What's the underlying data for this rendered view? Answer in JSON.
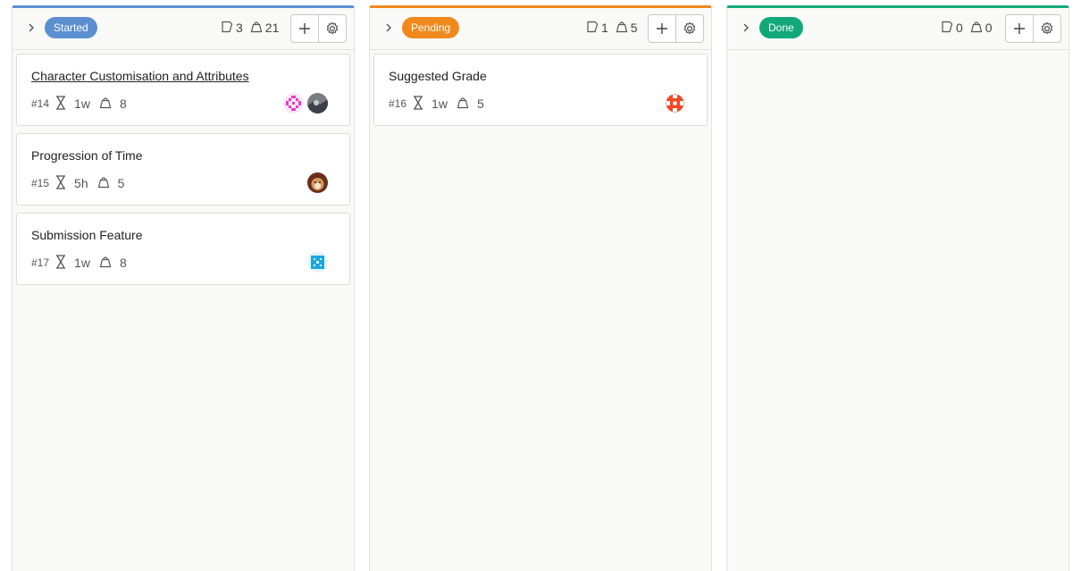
{
  "columns": [
    {
      "badge": "Started",
      "color": "#5b8fd0",
      "issue_count": "3",
      "weight_count": "21",
      "cards": [
        {
          "title": "Character Customisation and Attributes",
          "number": "#14",
          "estimate": "1w",
          "weight": "8",
          "avatars": [
            "pink-identicon",
            "photo-avatar"
          ]
        },
        {
          "title": "Progression of Time",
          "number": "#15",
          "estimate": "5h",
          "weight": "5",
          "avatars": [
            "dog-photo-avatar"
          ]
        },
        {
          "title": "Submission Feature",
          "number": "#17",
          "estimate": "1w",
          "weight": "8",
          "avatars": [
            "blue-identicon"
          ]
        }
      ]
    },
    {
      "badge": "Pending",
      "color": "#f0891c",
      "issue_count": "1",
      "weight_count": "5",
      "cards": [
        {
          "title": "Suggested Grade",
          "number": "#16",
          "estimate": "1w",
          "weight": "5",
          "avatars": [
            "red-identicon"
          ]
        }
      ]
    },
    {
      "badge": "Done",
      "color": "#12a87a",
      "issue_count": "0",
      "weight_count": "0",
      "cards": []
    }
  ]
}
